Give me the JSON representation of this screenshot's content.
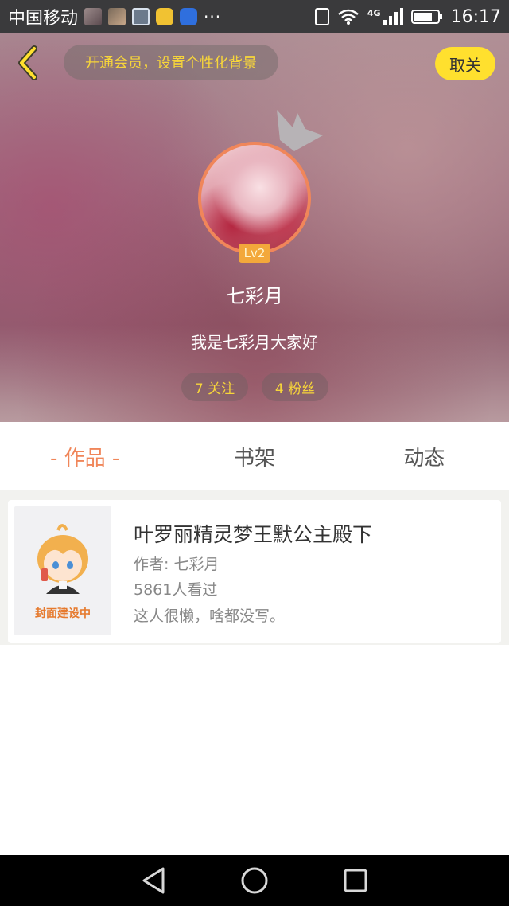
{
  "status_bar": {
    "carrier": "中国移动",
    "more": "···",
    "network": "4G",
    "time": "16:17"
  },
  "header": {
    "vip_banner": "开通会员，设置个性化背景",
    "unfollow_label": "取关",
    "level": "Lv2",
    "username": "七彩月",
    "signature": "我是七彩月大家好",
    "following": "7 关注",
    "fans": "4 粉丝"
  },
  "tabs": [
    {
      "label": "- 作品 -"
    },
    {
      "label": "书架"
    },
    {
      "label": "动态"
    }
  ],
  "works": [
    {
      "cover_text": "封面建设中",
      "title": "叶罗丽精灵梦王默公主殿下",
      "author": "作者: 七彩月",
      "views": "5861人看过",
      "description": "这人很懒，啥都没写。"
    }
  ],
  "colors": {
    "accent_orange": "#f0865a",
    "accent_yellow": "#ffe02e",
    "badge_text_yellow": "#f7d53a"
  },
  "icons": {
    "back": "back-arrow-icon",
    "crown": "crown-icon",
    "nav_back": "triangle-back-icon",
    "nav_home": "circle-home-icon",
    "nav_recent": "square-recent-icon"
  }
}
